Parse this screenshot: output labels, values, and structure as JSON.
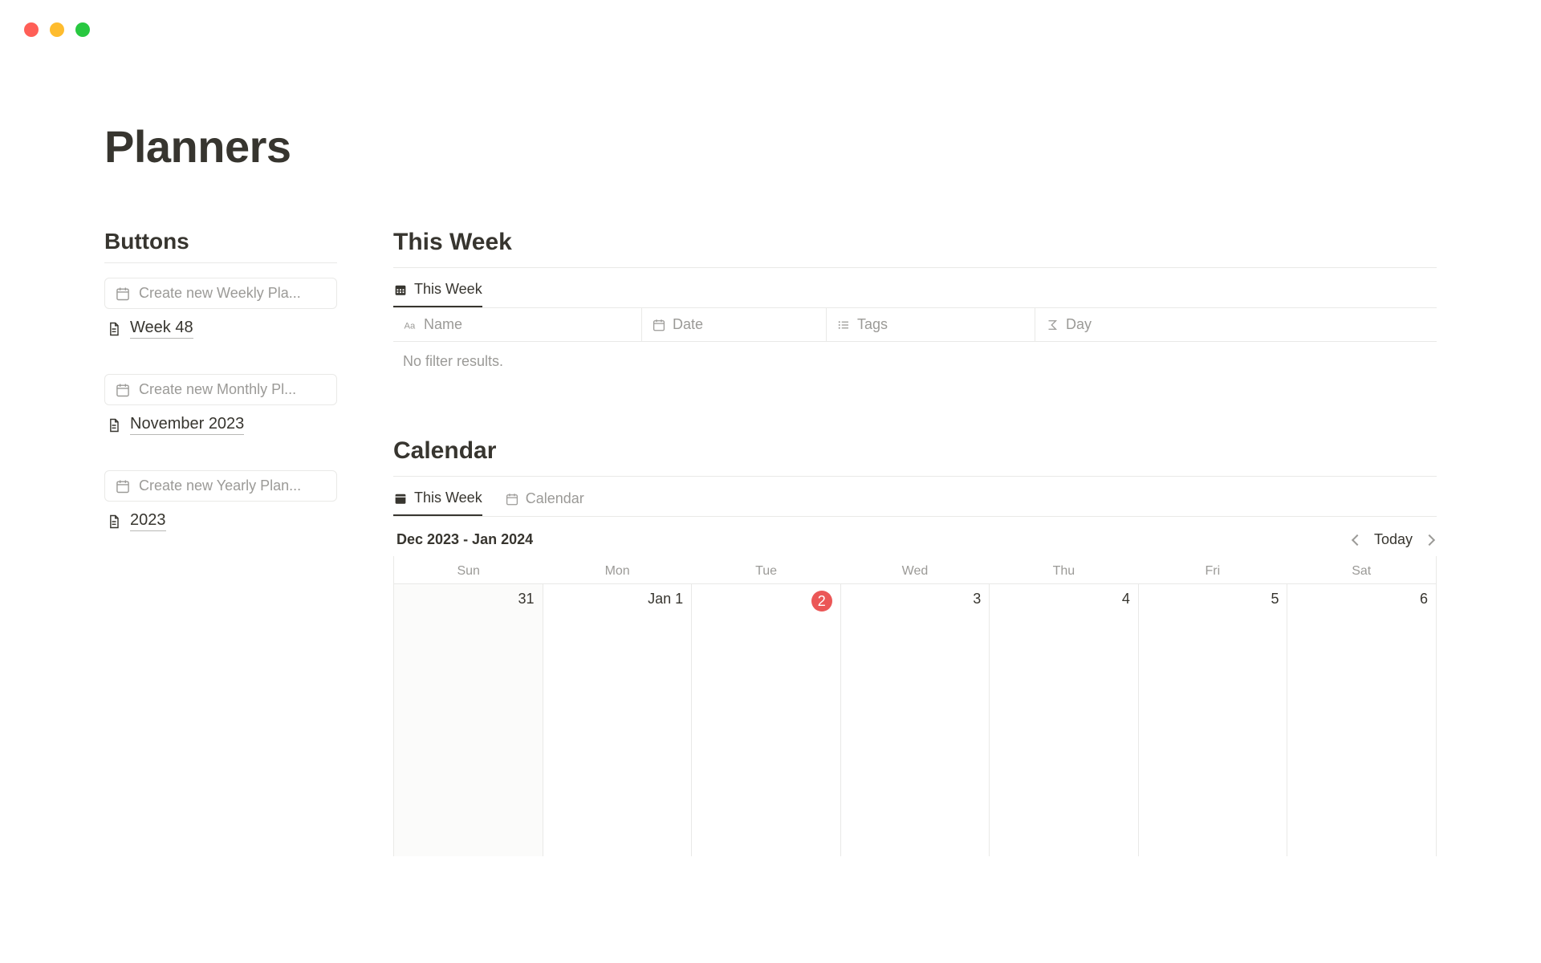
{
  "page_title": "Planners",
  "left": {
    "heading": "Buttons",
    "groups": [
      {
        "button_label": "Create new Weekly Pla...",
        "link_label": "Week 48"
      },
      {
        "button_label": "Create new Monthly Pl...",
        "link_label": "November 2023"
      },
      {
        "button_label": "Create new Yearly Plan...",
        "link_label": "2023"
      }
    ]
  },
  "this_week": {
    "heading": "This Week",
    "tab_label": "This Week",
    "columns": {
      "name": "Name",
      "date": "Date",
      "tags": "Tags",
      "day": "Day"
    },
    "empty": "No filter results."
  },
  "calendar": {
    "heading": "Calendar",
    "tabs": {
      "this_week": "This Week",
      "calendar": "Calendar"
    },
    "range": "Dec 2023 - Jan 2024",
    "today_label": "Today",
    "weekdays": [
      "Sun",
      "Mon",
      "Tue",
      "Wed",
      "Thu",
      "Fri",
      "Sat"
    ],
    "days": [
      {
        "label": "31",
        "other_month": true
      },
      {
        "label": "Jan 1"
      },
      {
        "label": "2",
        "today": true
      },
      {
        "label": "3"
      },
      {
        "label": "4"
      },
      {
        "label": "5"
      },
      {
        "label": "6"
      }
    ]
  }
}
